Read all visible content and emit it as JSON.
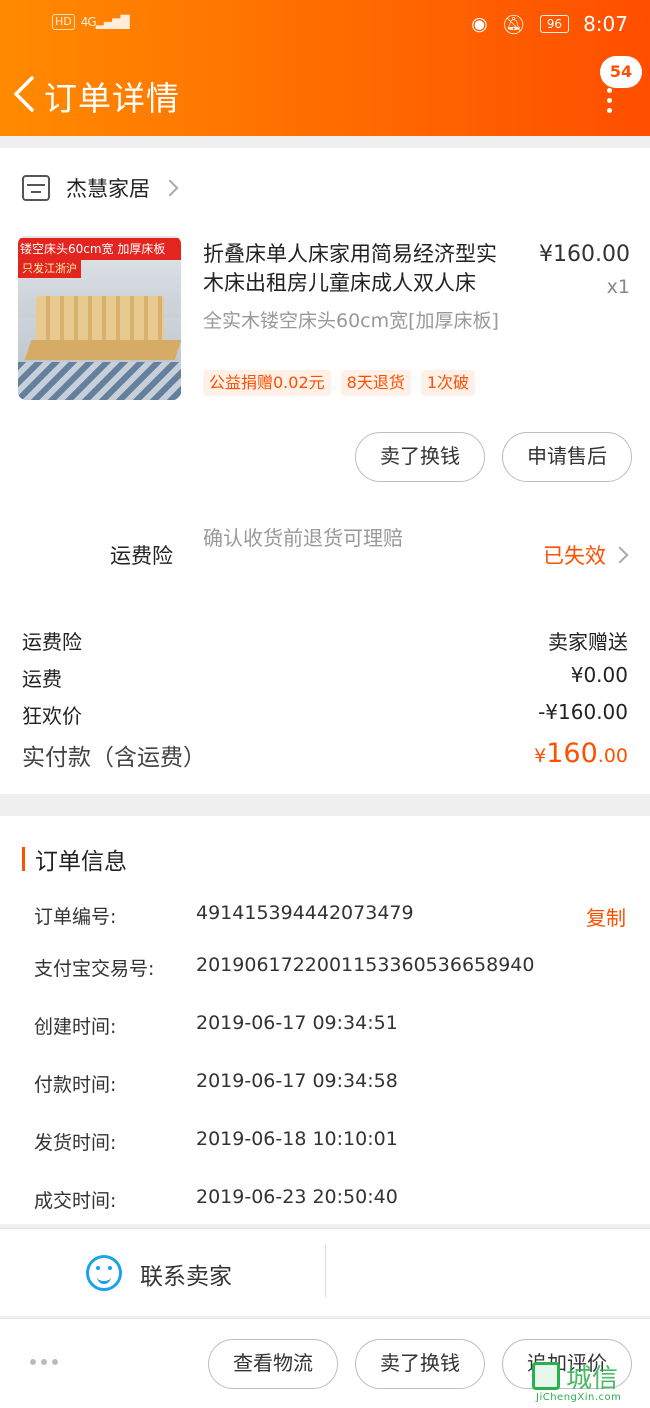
{
  "status_bar": {
    "hd": "HD",
    "signal": "4G",
    "battery": "96",
    "time": "8:07"
  },
  "header": {
    "title": "订单详情",
    "badge": "54"
  },
  "shop": {
    "name": "杰慧家居"
  },
  "product": {
    "image_tag1": "镂空床头60cm宽 加厚床板",
    "image_tag2": "只发江浙沪",
    "name": "折叠床单人床家用简易经济型实木床出租房儿童床成人双人床",
    "price": "¥160.00",
    "qty": "x1",
    "sku": "全实木镂空床头60cm宽[加厚床板]",
    "tags": [
      "公益捐赠0.02元",
      "8天退货",
      "1次破"
    ]
  },
  "product_actions": {
    "sell": "卖了换钱",
    "after_sale": "申请售后"
  },
  "insurance": {
    "label": "运费险",
    "desc": "确认收货前退货可理赔",
    "status": "已失效"
  },
  "summary": {
    "rows": [
      {
        "k": "运费险",
        "v": "卖家赠送"
      },
      {
        "k": "运费",
        "v": "¥0.00"
      },
      {
        "k": "狂欢价",
        "v": "-¥160.00"
      }
    ],
    "paid_label": "实付款（含运费）",
    "paid_currency": "¥",
    "paid_int": "160",
    "paid_dec": ".00"
  },
  "order_info": {
    "title": "订单信息",
    "copy": "复制",
    "rows": [
      {
        "k": "订单编号:",
        "v": "491415394442073479"
      },
      {
        "k": "支付宝交易号:",
        "v": "2019061722001153360536658940"
      },
      {
        "k": "创建时间:",
        "v": "2019-06-17 09:34:51"
      },
      {
        "k": "付款时间:",
        "v": "2019-06-17 09:34:58"
      },
      {
        "k": "发货时间:",
        "v": "2019-06-18 10:10:01"
      },
      {
        "k": "成交时间:",
        "v": "2019-06-23 20:50:40"
      }
    ]
  },
  "contact": {
    "label": "联系卖家"
  },
  "bottom_bar": {
    "logistics": "查看物流",
    "sell": "卖了换钱",
    "review": "追加评价"
  },
  "watermark": {
    "text": "城信",
    "url": "JiChengXin.com"
  }
}
